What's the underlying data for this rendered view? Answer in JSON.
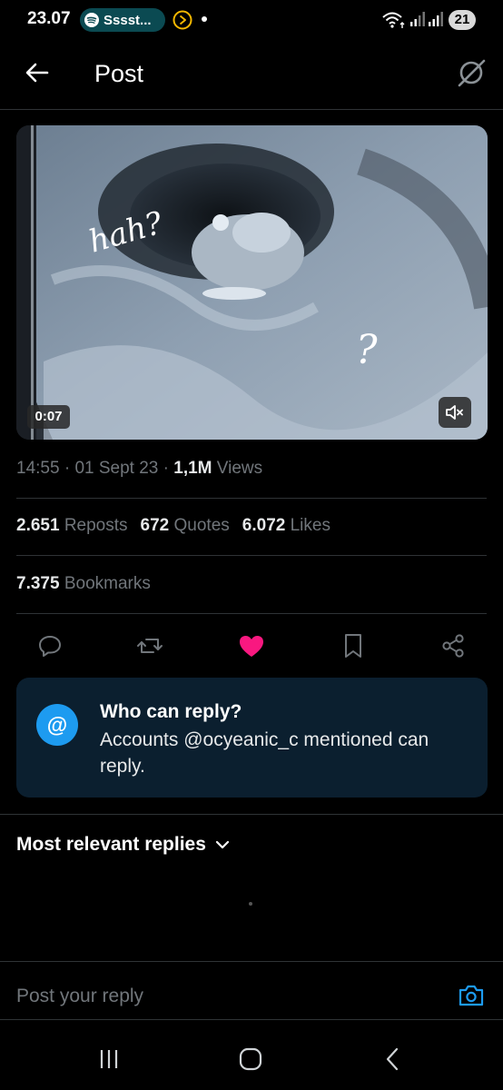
{
  "status_bar": {
    "time": "23.07",
    "media_label": "Sssst...",
    "battery": "21"
  },
  "header": {
    "title": "Post",
    "back_icon": "arrow-left-icon",
    "menu_icon": "grok-icon"
  },
  "media": {
    "overlay_text_1": "hah?",
    "overlay_text_2": "?",
    "duration": "0:07",
    "muted": true
  },
  "meta": {
    "time": "14:55",
    "date": "01 Sept 23",
    "views_count": "1,1M",
    "views_label": "Views"
  },
  "stats": {
    "reposts_count": "2.651",
    "reposts_label": "Reposts",
    "quotes_count": "672",
    "quotes_label": "Quotes",
    "likes_count": "6.072",
    "likes_label": "Likes",
    "bookmarks_count": "7.375",
    "bookmarks_label": "Bookmarks"
  },
  "actions": [
    {
      "icon": "reply-icon"
    },
    {
      "icon": "repost-icon"
    },
    {
      "icon": "heart-icon",
      "active": true
    },
    {
      "icon": "bookmark-icon"
    },
    {
      "icon": "share-icon"
    }
  ],
  "reply_restriction": {
    "icon_symbol": "@",
    "title": "Who can reply?",
    "body": "Accounts @ocyeanic_c mentioned can reply."
  },
  "replies": {
    "sort_label": "Most relevant replies"
  },
  "reply_box": {
    "placeholder": "Post your reply"
  },
  "colors": {
    "accent": "#1d9bf0",
    "like": "#f91880",
    "card_bg": "#0b1f2f",
    "muted_text": "#71767b"
  }
}
